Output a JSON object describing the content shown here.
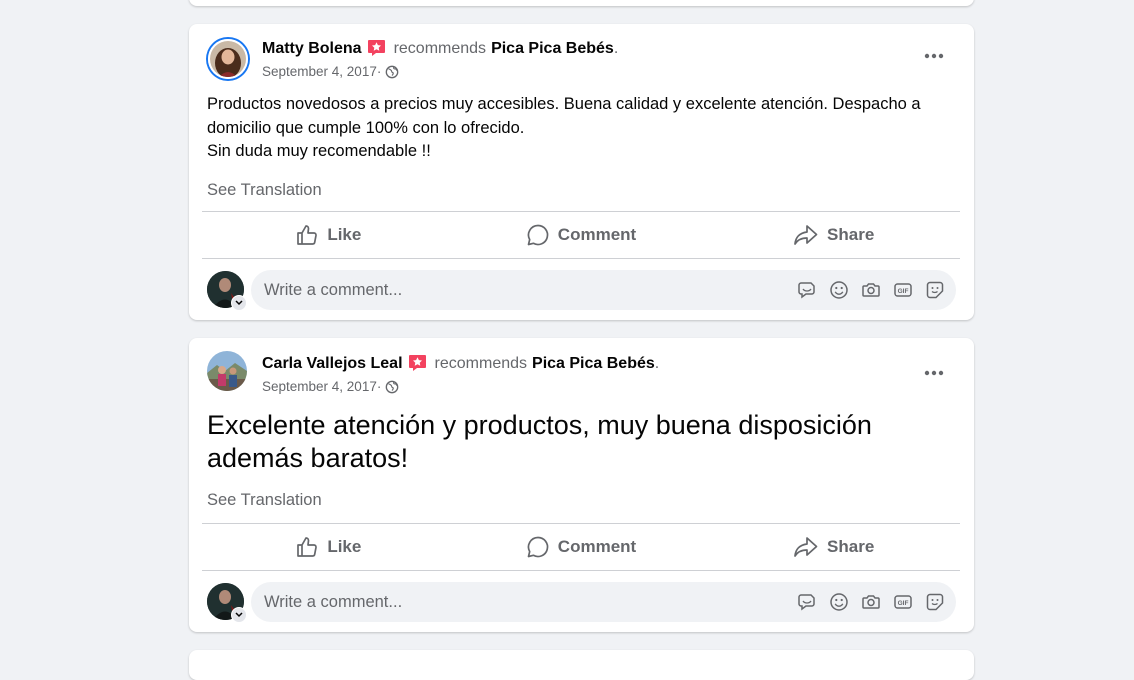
{
  "posts": [
    {
      "author": "Matty Bolena",
      "recommends": "recommends",
      "page": "Pica Pica Bebés",
      "period": ".",
      "date": "September 4, 2017",
      "date_sep": " ·",
      "text": "Productos novedosos a precios muy accesibles. Buena calidad y excelente atención. Despacho a domicilio que cumple 100% con lo ofrecido.\nSin duda muy recomendable !!",
      "see_translation": "See Translation"
    },
    {
      "author": "Carla Vallejos Leal",
      "recommends": "recommends",
      "page": "Pica Pica Bebés",
      "period": ".",
      "date": "September 4, 2017",
      "date_sep": " ·",
      "text": "Excelente atención y productos, muy buena disposición además baratos!",
      "see_translation": "See Translation"
    }
  ],
  "actions": {
    "like": "Like",
    "comment": "Comment",
    "share": "Share"
  },
  "comment_placeholder": "Write a comment...",
  "icons": {
    "recommend_badge": "recommend-star-icon",
    "privacy": "globe-icon",
    "more": "more-dots-icon",
    "like": "thumbs-up-icon",
    "comment": "speech-bubble-icon",
    "share": "share-arrow-icon",
    "avatar_sticker": "avatar-sticker-icon",
    "emoji": "emoji-icon",
    "camera": "camera-icon",
    "gif": "gif-icon",
    "sticker": "sticker-icon"
  },
  "colors": {
    "background": "#f0f2f5",
    "card": "#ffffff",
    "secondary_text": "#65676b",
    "badge": "#f3425f",
    "accent": "#1877f2"
  }
}
